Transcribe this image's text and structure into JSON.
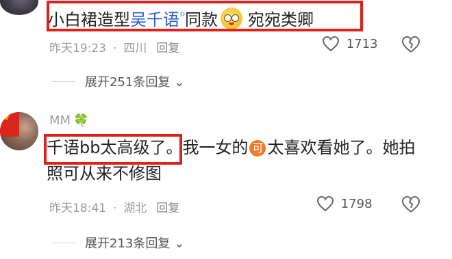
{
  "comment1": {
    "text_prefix": "小白裙造型",
    "linked_name": "吴千语",
    "search_marker": "ᴼ",
    "text_after_link": "同款",
    "emoji": "smiling-drooling-emoji",
    "text_suffix": "宛宛类卿",
    "time": "昨天19:23",
    "separator": "·",
    "location": "四川",
    "reply_label": "回复",
    "like_count": "1713",
    "expand_label": "展开251条回复",
    "expand_chevron": "⌄"
  },
  "comment2": {
    "username": "MM",
    "username_badge": "🍀",
    "text_highlighted": "千语bb太高级了",
    "text_rest_1": "。我一女的",
    "badge_text": "可",
    "text_rest_2": "太喜欢看她了。她拍照可从来不修图",
    "time": "昨天18:41",
    "separator": "·",
    "location": "湖北",
    "reply_label": "回复",
    "like_count": "1798",
    "expand_label": "展开213条回复",
    "expand_chevron": "⌄"
  },
  "colors": {
    "highlight_box": "#e0211b",
    "link_blue": "#2a5bd7",
    "meta_gray": "#9a9a9a"
  }
}
